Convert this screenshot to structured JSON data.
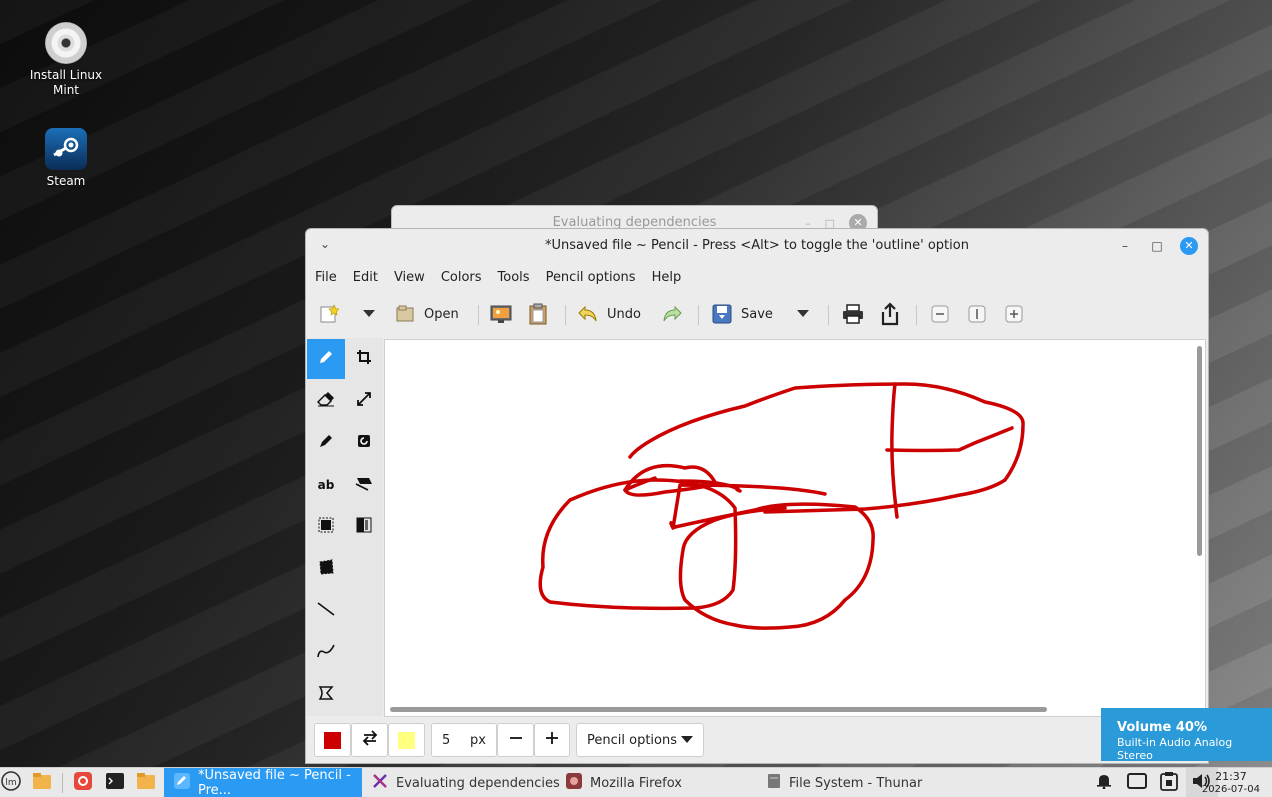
{
  "desktop": {
    "icons": [
      {
        "label": "Install Linux Mint",
        "icon": "disc-icon"
      },
      {
        "label": "Steam",
        "icon": "steam-icon"
      }
    ]
  },
  "background_window": {
    "title": "Evaluating dependencies"
  },
  "window": {
    "title": "*Unsaved file ~ Pencil - Press <Alt> to toggle the 'outline' option",
    "menu": [
      "File",
      "Edit",
      "View",
      "Colors",
      "Tools",
      "Pencil options",
      "Help"
    ],
    "toolbar": {
      "open_label": "Open",
      "undo_label": "Undo",
      "save_label": "Save"
    },
    "tools": [
      "pencil-icon",
      "crop-icon",
      "eraser-icon",
      "scale-icon",
      "highlighter-icon",
      "rotate-icon",
      "text-icon",
      "skew-icon",
      "rect-select-icon",
      "filters-icon",
      "free-select-icon",
      "line-icon",
      "curve-icon",
      "shape-icon"
    ],
    "bottom": {
      "main_color": "#cc0000",
      "secondary_color": "#ffff80",
      "size_value": "5",
      "size_unit": "px",
      "options_label": "Pencil options"
    }
  },
  "notification": {
    "title": "Volume 40%",
    "subtitle": "Built-in Audio Analog Stereo"
  },
  "taskbar": {
    "tasks": [
      {
        "label": "*Unsaved file ~ Pencil - Pre...",
        "active": true
      },
      {
        "label": "Evaluating dependencies",
        "active": false
      },
      {
        "label": "Mozilla Firefox",
        "active": false
      },
      {
        "label": "File System - Thunar",
        "active": false
      }
    ],
    "time": "21:37",
    "date": "2026-07-04"
  },
  "colors": {
    "accent": "#2b9af3",
    "stroke": "#cc0000"
  }
}
